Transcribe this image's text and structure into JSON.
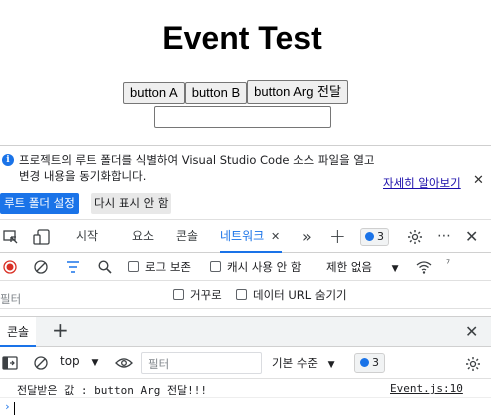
{
  "page": {
    "title": "Event Test",
    "buttons": [
      "button A",
      "button B",
      "button Arg 전달"
    ],
    "input_value": ""
  },
  "infobar": {
    "message": "프로젝트의 루트 폴더를 식별하여 Visual Studio Code 소스 파일을 열고 변경 내용을 동기화합니다.",
    "learn_more": "자세히 알아보기",
    "primary_button": "루트 폴더 설정",
    "secondary_button": "다시 표시 안 함"
  },
  "main_tabs": {
    "items": [
      "시작",
      "요소",
      "콘솔",
      "네트워크"
    ],
    "active": "네트워크",
    "issues_count": "3"
  },
  "network_toolbar": {
    "preserve_log": "로그 보존",
    "disable_cache": "캐시 사용 안 함",
    "throttling": "제한 없음"
  },
  "network_filter": {
    "placeholder": "필터",
    "invert": "거꾸로",
    "hide_data_urls": "데이터 URL 숨기기"
  },
  "drawer": {
    "tab": "콘솔"
  },
  "console_toolbar": {
    "context": "top",
    "filter_placeholder": "필터",
    "level": "기본 수준",
    "issues_count": "3"
  },
  "console_log": {
    "message": "전달받은 값 : button Arg 전달!!!",
    "source": "Event.js:10"
  },
  "colors": {
    "accent": "#1a73e8",
    "record": "#d93025"
  }
}
